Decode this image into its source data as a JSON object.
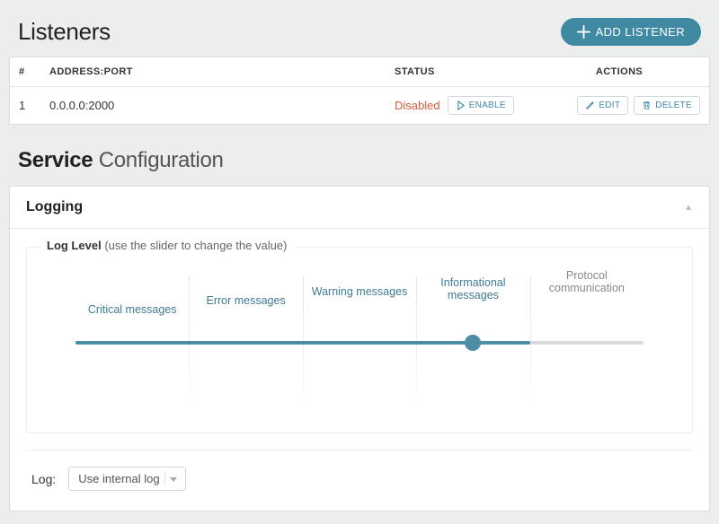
{
  "listeners": {
    "title": "Listeners",
    "add_button": "ADD LISTENER",
    "columns": {
      "num": "#",
      "address": "ADDRESS:PORT",
      "status": "STATUS",
      "actions": "ACTIONS"
    },
    "rows": [
      {
        "num": "1",
        "address": "0.0.0.0:2000",
        "status": "Disabled",
        "enable_label": "ENABLE",
        "edit_label": "EDIT",
        "delete_label": "DELETE"
      }
    ]
  },
  "service": {
    "title_strong": "Service",
    "title_light": "Configuration"
  },
  "logging": {
    "panel_title": "Logging",
    "legend_strong": "Log Level",
    "legend_hint": "(use the slider to change the value)",
    "levels": [
      {
        "label": "Critical messages",
        "active": true
      },
      {
        "label": "Error messages",
        "active": true
      },
      {
        "label": "Warning messages",
        "active": true
      },
      {
        "label": "Informational messages",
        "active": true
      },
      {
        "label": "Protocol communication",
        "active": false
      }
    ],
    "selected_index": 3,
    "log_label": "Log:",
    "log_select_value": "Use internal log"
  }
}
